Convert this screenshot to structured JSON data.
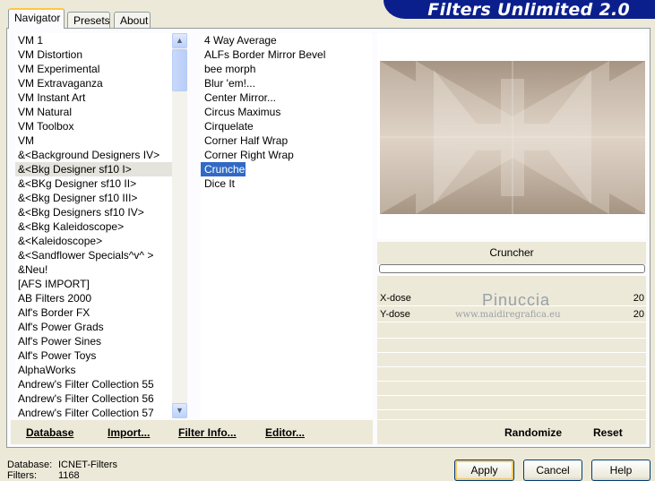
{
  "banner": {
    "title": "Filters Unlimited 2.0"
  },
  "tabs": [
    "Navigator",
    "Presets",
    "About"
  ],
  "categories": [
    "VM 1",
    "VM Distortion",
    "VM Experimental",
    "VM Extravaganza",
    "VM Instant Art",
    "VM Natural",
    "VM Toolbox",
    "VM",
    "&<Background Designers IV>",
    "&<Bkg Designer sf10 I>",
    "&<BKg Designer sf10 II>",
    "&<Bkg Designer sf10 III>",
    "&<Bkg Designers sf10 IV>",
    "&<Bkg Kaleidoscope>",
    "&<Kaleidoscope>",
    "&<Sandflower Specials^v^ >",
    "&Neu!",
    "[AFS IMPORT]",
    "AB Filters 2000",
    "Alf's Border FX",
    "Alf's Power Grads",
    "Alf's Power Sines",
    "Alf's Power Toys",
    "AlphaWorks",
    "Andrew's Filter Collection 55",
    "Andrew's Filter Collection 56",
    "Andrew's Filter Collection 57"
  ],
  "filters": [
    "4 Way Average",
    "ALFs Border Mirror Bevel",
    "bee morph",
    "Blur 'em!...",
    "Center Mirror...",
    "Circus Maximus",
    "Cirquelate",
    "Corner Half Wrap",
    "Corner Right Wrap",
    "Cruncher",
    "Dice It"
  ],
  "preview": {
    "filter_name": "Cruncher",
    "progress": 0,
    "params": [
      {
        "label": "X-dose",
        "value": "20"
      },
      {
        "label": "Y-dose",
        "value": "20"
      }
    ],
    "watermark_name": "Pinuccia",
    "watermark_url": "www.maidiregrafica.eu"
  },
  "link_bar": {
    "database": "Database",
    "import": "Import...",
    "filter_info": "Filter Info...",
    "editor": "Editor..."
  },
  "right_bar": {
    "randomize": "Randomize",
    "reset": "Reset"
  },
  "status": {
    "database_label": "Database:",
    "database_value": "ICNET-Filters",
    "filters_label": "Filters:",
    "filters_value": "1168"
  },
  "buttons": {
    "apply": "Apply",
    "cancel": "Cancel",
    "help": "Help"
  },
  "colors": {
    "banner": "#0b1f8c",
    "selection": "#316ac5",
    "tab_highlight": "#ffc83c"
  }
}
